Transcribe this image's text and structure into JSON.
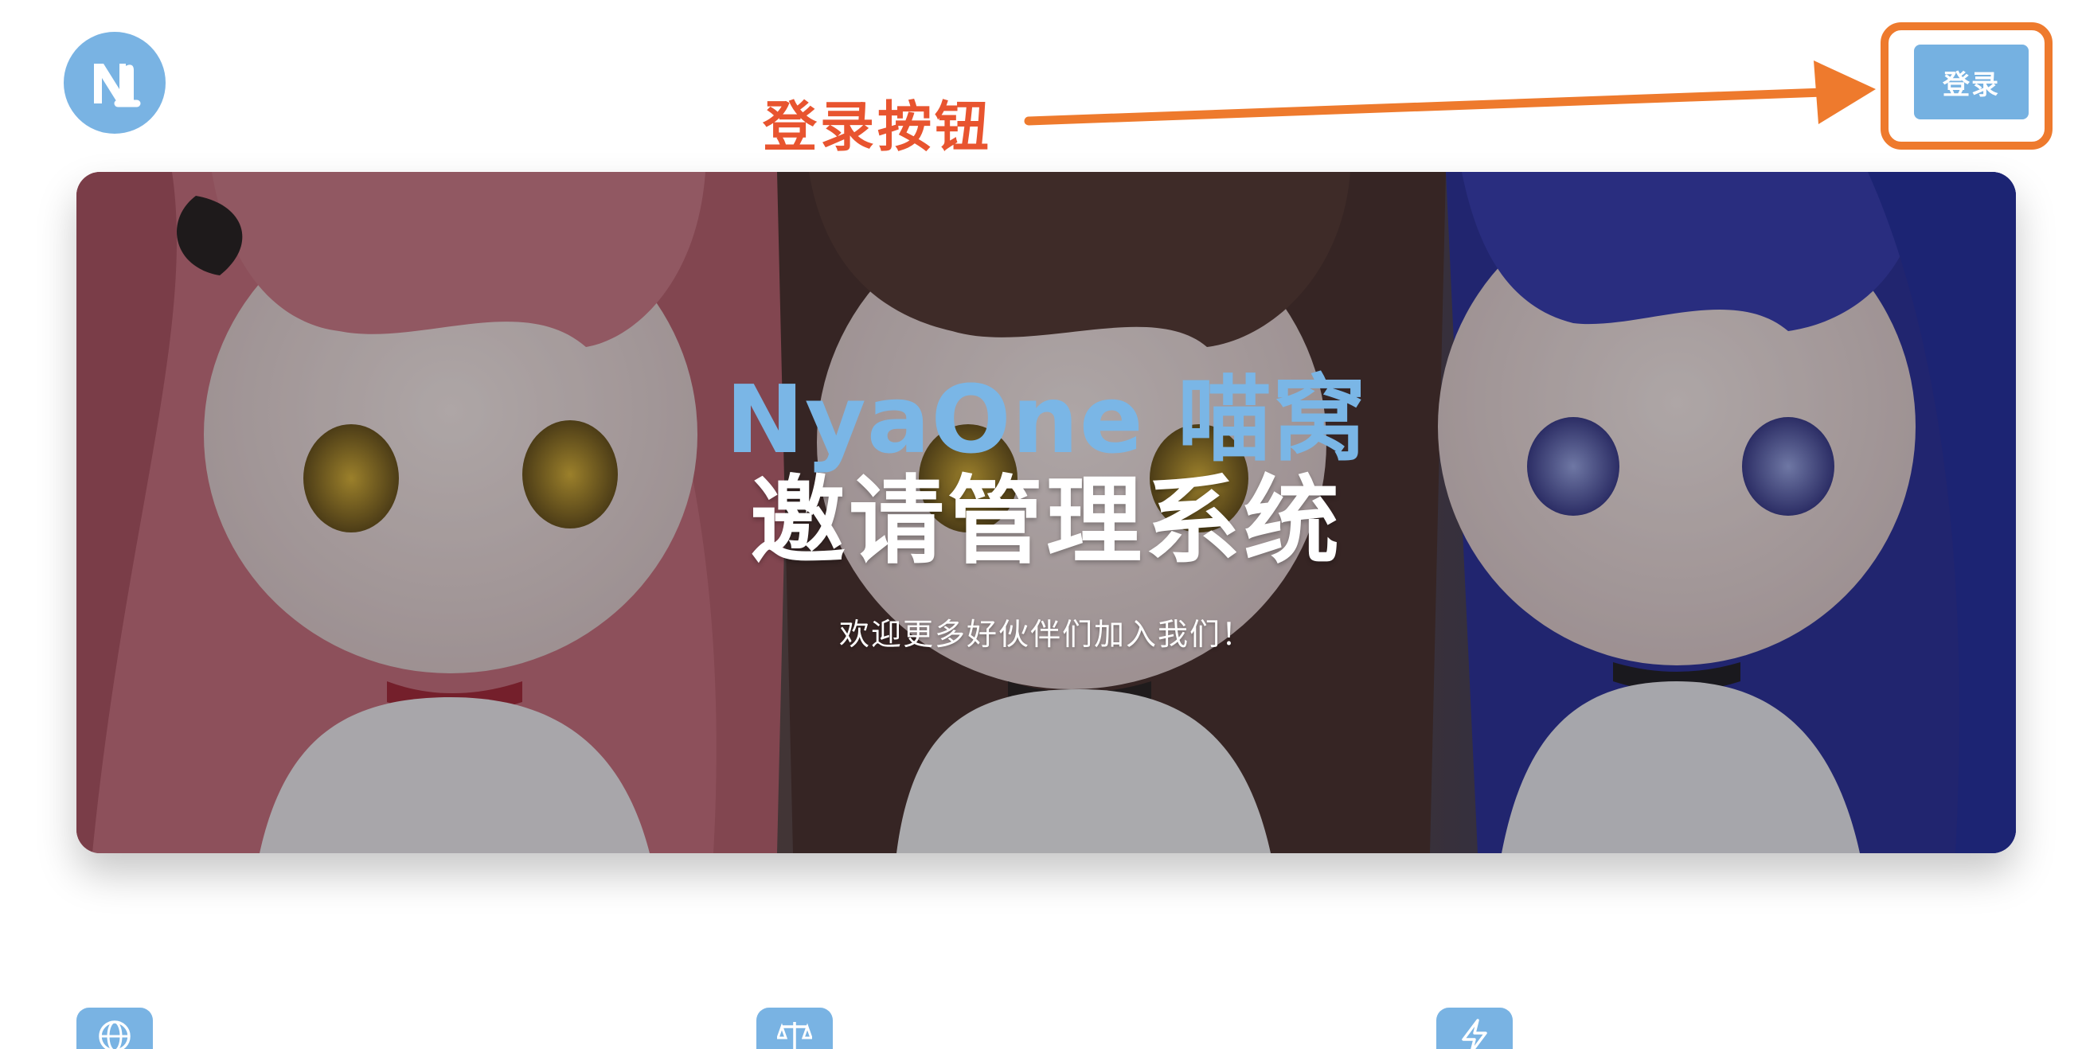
{
  "logo": {
    "icon": "nyaone-logo-icon"
  },
  "header": {
    "login_label": "登录"
  },
  "annotation": {
    "label": "登录按钮"
  },
  "hero": {
    "title_line1": "NyaOne 喵窝",
    "title_line2": "邀请管理系统",
    "subtitle": "欢迎更多好伙伴们加入我们！"
  },
  "features": [
    {
      "icon": "globe-icon"
    },
    {
      "icon": "scale-icon"
    },
    {
      "icon": "lightning-icon"
    }
  ],
  "colors": {
    "accent": "#79b3e3",
    "annotation": "#ee7a2d",
    "annotation_text": "#e8542f"
  }
}
